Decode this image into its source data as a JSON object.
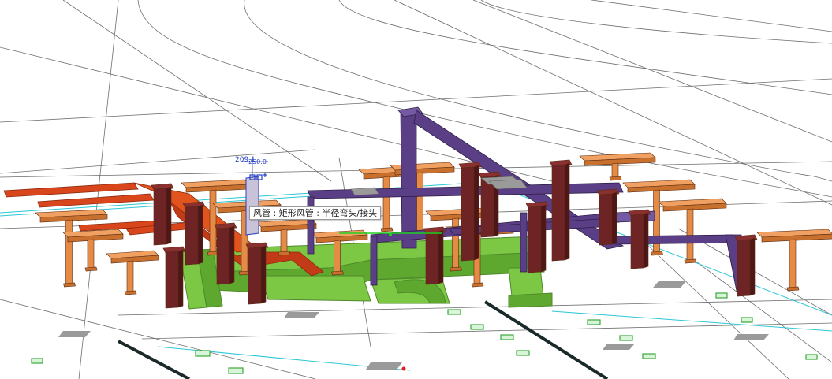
{
  "viewport": {
    "label": ""
  },
  "tooltip": {
    "text": "风管 : 矩形风管 : 半径弯头/接头"
  },
  "dimensions": [
    {
      "value": "209.1"
    },
    {
      "value": "250.0"
    }
  ],
  "colors": {
    "background": "#ffffff",
    "supply_duct": "#d9461c",
    "return_duct": "#5b3f86",
    "exhaust_duct": "#7cc744",
    "column": "#6e2424",
    "hanger": "#e58b46",
    "floor_pad": "#9a9a9a",
    "cad_line": "#555555",
    "cyan_line": "#2bc7d6",
    "blue_ui": "#2440c8"
  },
  "icons": [
    "grip-handle-icon",
    "move-arrows-icon"
  ]
}
